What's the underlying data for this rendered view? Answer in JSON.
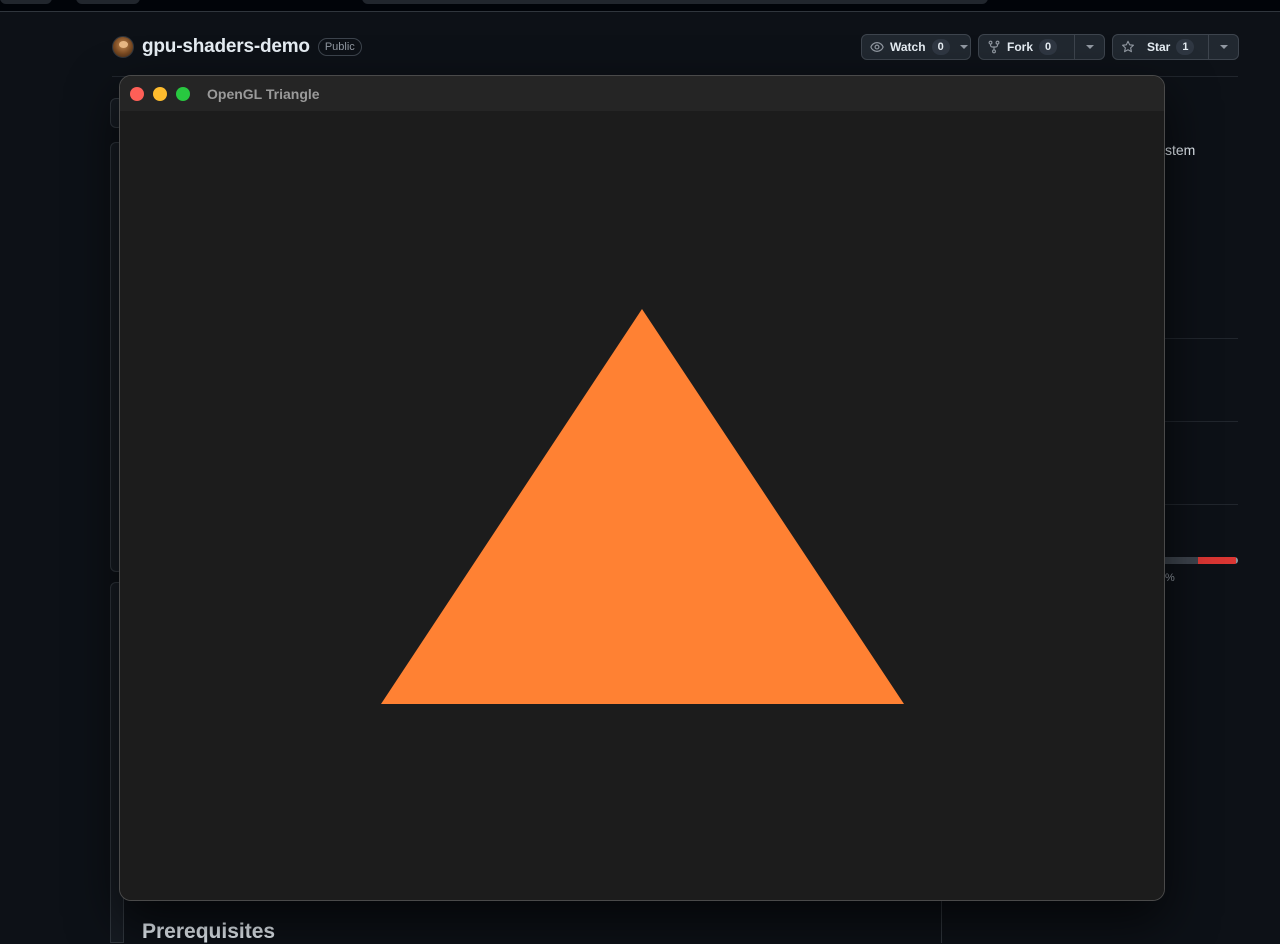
{
  "repo": {
    "name": "gpu-shaders-demo",
    "visibility": "Public"
  },
  "actions": {
    "watch": {
      "label": "Watch",
      "count": "0"
    },
    "fork": {
      "label": "Fork",
      "count": "0"
    },
    "star": {
      "label": "Star",
      "count": "1"
    }
  },
  "background_fragments": {
    "about_text_fragment": "stem",
    "percent_fragment": "%",
    "section_heading": "Prerequisites"
  },
  "window": {
    "title": "OpenGL Triangle",
    "controls": [
      "close",
      "minimize",
      "maximize"
    ],
    "background_color": "#1c1c1c",
    "shape": {
      "type": "triangle",
      "color": "#ff8133"
    }
  },
  "colors": {
    "page_bg": "#0d1117",
    "close": "#fe5f57",
    "minimize": "#febc2e",
    "maximize": "#28c840",
    "language_bar": [
      "#3d444d",
      "#da3633"
    ]
  }
}
